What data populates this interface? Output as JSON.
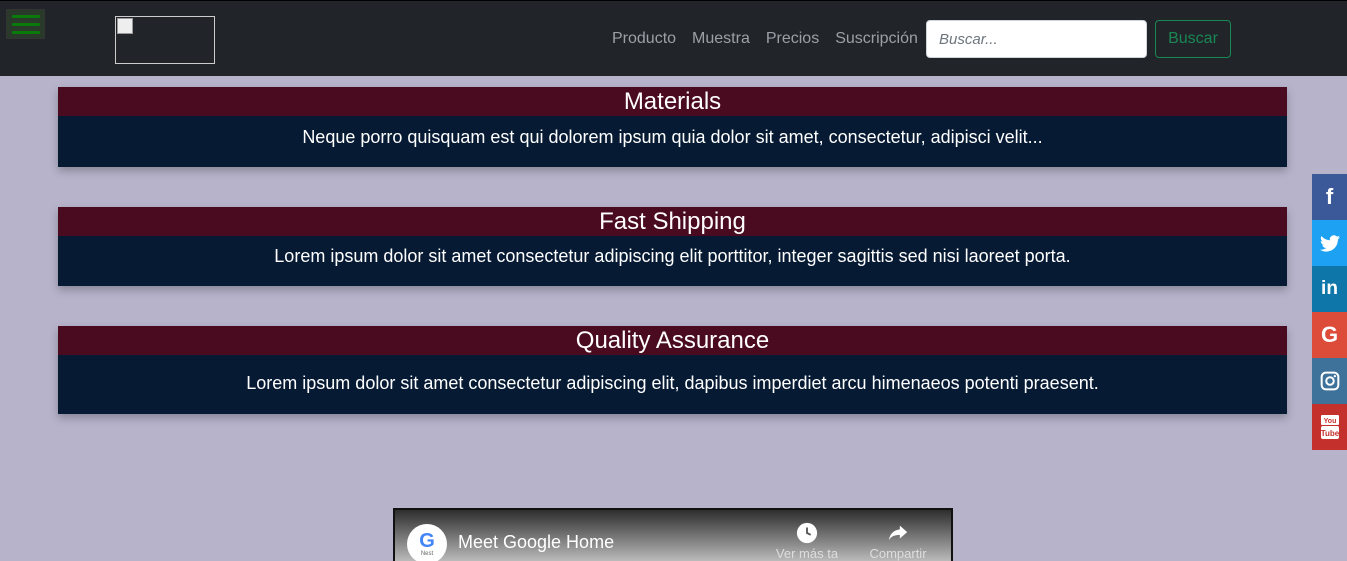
{
  "navbar": {
    "menu_icon": "hamburger-icon",
    "logo_alt": "",
    "links": [
      "Producto",
      "Muestra",
      "Precios",
      "Suscripción"
    ],
    "search_placeholder": "Buscar...",
    "search_button": "Buscar",
    "colors": {
      "background": "#212529",
      "button_accent": "#198754"
    }
  },
  "features": [
    {
      "title": "Materials",
      "text": "Neque porro quisquam est qui dolorem ipsum quia dolor sit amet, consectetur, adipisci velit..."
    },
    {
      "title": "Fast Shipping",
      "text": "Lorem ipsum dolor sit amet consectetur adipiscing elit porttitor, integer sagittis sed nisi laoreet porta."
    },
    {
      "title": "Quality Assurance",
      "text": "Lorem ipsum dolor sit amet consectetur adipiscing elit, dapibus imperdiet arcu himenaeos potenti praesent."
    }
  ],
  "feature_colors": {
    "title_bg": "#4a0a20",
    "body_bg": "#061a33"
  },
  "social": [
    {
      "icon": "facebook-icon",
      "glyph": "f",
      "color": "#3b5998"
    },
    {
      "icon": "twitter-icon",
      "glyph": "",
      "color": "#1da1f2"
    },
    {
      "icon": "linkedin-icon",
      "glyph": "in",
      "color": "#0e76a8"
    },
    {
      "icon": "google-icon",
      "glyph": "G",
      "color": "#dd4b39"
    },
    {
      "icon": "instagram-icon",
      "glyph": "",
      "color": "#3f729b"
    },
    {
      "icon": "youtube-icon",
      "glyph": "You Tube",
      "color": "#c4302b"
    }
  ],
  "video": {
    "channel_avatar": "G",
    "channel_sub": "Nest",
    "title": "Meet Google Home",
    "watch_later": "Ver más ta",
    "share": "Compartir"
  },
  "page_bg": "#b7b3cb"
}
